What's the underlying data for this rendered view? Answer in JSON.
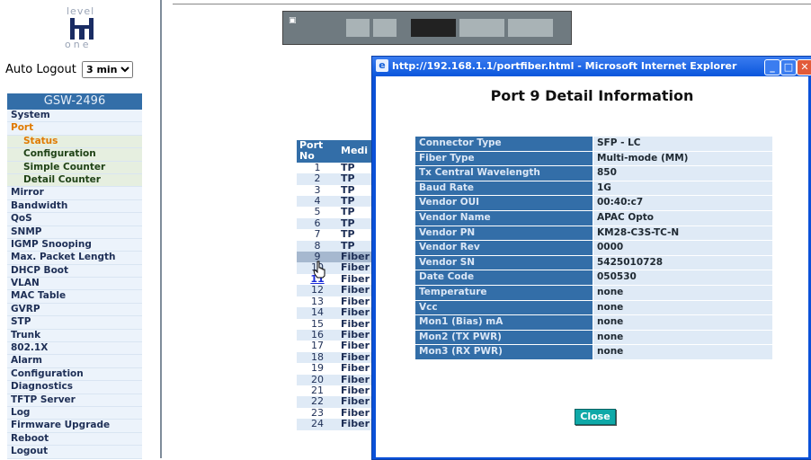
{
  "left": {
    "logo_top": "level",
    "logo_bottom": "one",
    "autologout_label": "Auto Logout",
    "autologout_value": "3 min",
    "device": "GSW-2496",
    "menu": [
      {
        "label": "System",
        "type": "item"
      },
      {
        "label": "Port",
        "type": "open"
      },
      {
        "label": "Status",
        "type": "sub-active"
      },
      {
        "label": "Configuration",
        "type": "sub"
      },
      {
        "label": "Simple Counter",
        "type": "sub"
      },
      {
        "label": "Detail Counter",
        "type": "sub"
      },
      {
        "label": "Mirror",
        "type": "item"
      },
      {
        "label": "Bandwidth",
        "type": "item"
      },
      {
        "label": "QoS",
        "type": "item"
      },
      {
        "label": "SNMP",
        "type": "item"
      },
      {
        "label": "IGMP Snooping",
        "type": "item"
      },
      {
        "label": "Max. Packet Length",
        "type": "item"
      },
      {
        "label": "DHCP Boot",
        "type": "item"
      },
      {
        "label": "VLAN",
        "type": "item"
      },
      {
        "label": "MAC Table",
        "type": "item"
      },
      {
        "label": "GVRP",
        "type": "item"
      },
      {
        "label": "STP",
        "type": "item"
      },
      {
        "label": "Trunk",
        "type": "item"
      },
      {
        "label": "802.1X",
        "type": "item"
      },
      {
        "label": "Alarm",
        "type": "item"
      },
      {
        "label": "Configuration",
        "type": "item"
      },
      {
        "label": "Diagnostics",
        "type": "item"
      },
      {
        "label": "TFTP Server",
        "type": "item"
      },
      {
        "label": "Log",
        "type": "item"
      },
      {
        "label": "Firmware Upgrade",
        "type": "item"
      },
      {
        "label": "Reboot",
        "type": "item"
      },
      {
        "label": "Logout",
        "type": "item"
      }
    ]
  },
  "ports": {
    "headers": [
      "Port No",
      "Medi"
    ],
    "rows": [
      [
        "1",
        "TP"
      ],
      [
        "2",
        "TP"
      ],
      [
        "3",
        "TP"
      ],
      [
        "4",
        "TP"
      ],
      [
        "5",
        "TP"
      ],
      [
        "6",
        "TP"
      ],
      [
        "7",
        "TP"
      ],
      [
        "8",
        "TP"
      ],
      [
        "9",
        "Fiber"
      ],
      [
        "10",
        "Fiber"
      ],
      [
        "11",
        "Fiber"
      ],
      [
        "12",
        "Fiber"
      ],
      [
        "13",
        "Fiber"
      ],
      [
        "14",
        "Fiber"
      ],
      [
        "15",
        "Fiber"
      ],
      [
        "16",
        "Fiber"
      ],
      [
        "17",
        "Fiber"
      ],
      [
        "18",
        "Fiber"
      ],
      [
        "19",
        "Fiber"
      ],
      [
        "20",
        "Fiber"
      ],
      [
        "21",
        "Fiber"
      ],
      [
        "22",
        "Fiber"
      ],
      [
        "23",
        "Fiber"
      ],
      [
        "24",
        "Fiber"
      ]
    ],
    "selected_port": "9",
    "linked_port": "11"
  },
  "popup": {
    "window_title": "http://192.168.1.1/portfiber.html - Microsoft Internet Explorer",
    "heading": "Port 9 Detail Information",
    "fields": [
      {
        "key": "Connector Type",
        "value": "SFP - LC"
      },
      {
        "key": "Fiber Type",
        "value": "Multi-mode (MM)"
      },
      {
        "key": "Tx Central Wavelength",
        "value": "850"
      },
      {
        "key": "Baud Rate",
        "value": "1G"
      },
      {
        "key": "Vendor OUI",
        "value": "00:40:c7"
      },
      {
        "key": "Vendor Name",
        "value": "APAC Opto"
      },
      {
        "key": "Vendor PN",
        "value": "KM28-C3S-TC-N"
      },
      {
        "key": "Vendor Rev",
        "value": "0000"
      },
      {
        "key": "Vendor SN",
        "value": "5425010728"
      },
      {
        "key": "Date Code",
        "value": "050530"
      },
      {
        "key": "Temperature",
        "value": "none"
      },
      {
        "key": "Vcc",
        "value": "none"
      },
      {
        "key": "Mon1 (Bias) mA",
        "value": "none"
      },
      {
        "key": "Mon2 (TX PWR)",
        "value": "none"
      },
      {
        "key": "Mon3 (RX PWR)",
        "value": "none"
      }
    ],
    "close_label": "Close"
  }
}
